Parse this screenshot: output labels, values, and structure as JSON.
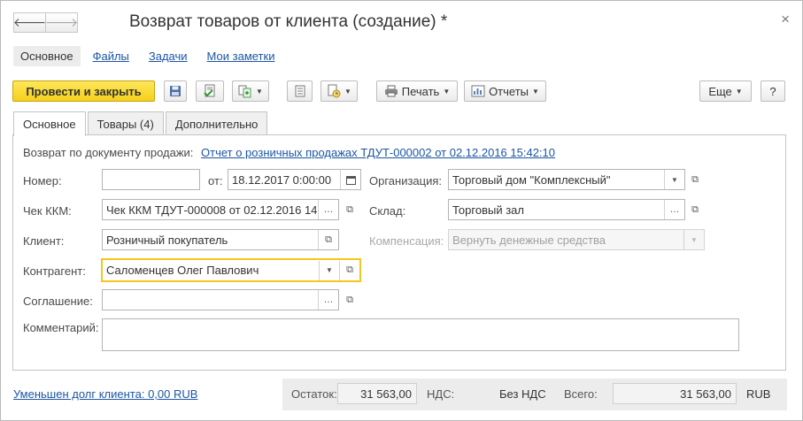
{
  "header": {
    "title": "Возврат товаров от клиента (создание) *",
    "back_icon": "arrow-left-icon",
    "forward_icon": "arrow-right-icon",
    "close_glyph": "×"
  },
  "sections": [
    "Основное",
    "Файлы",
    "Задачи",
    "Мои заметки"
  ],
  "toolbar": {
    "post_close": "Провести и закрыть",
    "print": "Печать",
    "reports": "Отчеты",
    "more": "Еще",
    "help": "?"
  },
  "tabs": [
    "Основное",
    "Товары (4)",
    "Дополнительно"
  ],
  "form": {
    "sale_doc_label": "Возврат по документу продажи:",
    "sale_doc_link": "Отчет о розничных продажах ТДУТ-000002 от 02.12.2016 15:42:10",
    "number_label": "Номер:",
    "number_value": "",
    "date_label": "от:",
    "date_value": "18.12.2017  0:00:00",
    "receipt_label": "Чек ККМ:",
    "receipt_value": "Чек ККМ ТДУТ-000008 от 02.12.2016 14:",
    "client_label": "Клиент:",
    "client_value": "Розничный покупатель",
    "counterparty_label": "Контрагент:",
    "counterparty_value": "Саломенцев Олег Павлович",
    "agreement_label": "Соглашение:",
    "agreement_value": "",
    "comment_label": "Комментарий:",
    "comment_value": "",
    "org_label": "Организация:",
    "org_value": "Торговый дом \"Комплексный\"",
    "warehouse_label": "Склад:",
    "warehouse_value": "Торговый зал",
    "compensation_label": "Компенсация:",
    "compensation_value": "Вернуть денежные средства"
  },
  "footer": {
    "debt_link": "Уменьшен долг клиента: 0,00 RUB",
    "balance_label": "Остаток:",
    "balance_value": "31 563,00",
    "vat_label": "НДС:",
    "vat_value": "Без НДС",
    "total_label": "Всего:",
    "total_value": "31 563,00",
    "currency": "RUB"
  },
  "colors": {
    "primary_button": "#f5cf1a",
    "link": "#1c55a4",
    "focus_border": "#f5c71a"
  }
}
